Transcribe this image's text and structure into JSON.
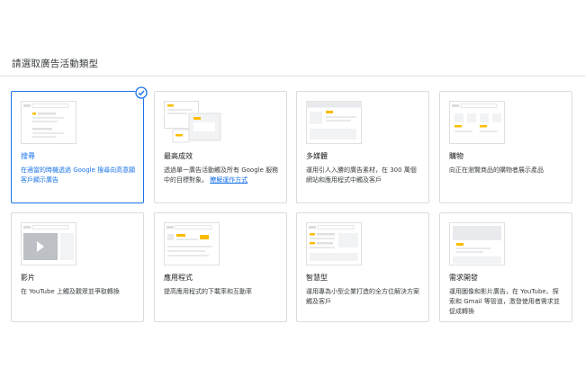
{
  "page": {
    "title": "請選取廣告活動類型"
  },
  "colors": {
    "selected_accent": "#1a73e8",
    "thumb_accent": "#fbbc04",
    "thumb_gray": "#e0e0e0"
  },
  "cards": [
    {
      "id": "search",
      "title": "搜尋",
      "desc": "在適當的時機透過 Google 搜尋向高意願客戶顯示廣告",
      "selected": true,
      "icon": "search-results-thumbnail"
    },
    {
      "id": "performance_max",
      "title": "最高成效",
      "desc": "透過單一廣告活動觸及所有 Google 服務中的目標對象。",
      "link": "瞭解運作方式",
      "selected": false,
      "icon": "multi-channel-thumbnail"
    },
    {
      "id": "display",
      "title": "多媒體",
      "desc": "運用引人入勝的廣告素材，在 300 萬個網站和應用程式中觸及客戶",
      "selected": false,
      "icon": "display-site-thumbnail"
    },
    {
      "id": "shopping",
      "title": "購物",
      "desc": "向正在瀏覽商品的購物者展示產品",
      "selected": false,
      "icon": "shopping-grid-thumbnail"
    },
    {
      "id": "video",
      "title": "影片",
      "desc": "在 YouTube 上觸及觀眾並爭取轉換",
      "selected": false,
      "icon": "video-player-thumbnail"
    },
    {
      "id": "app",
      "title": "應用程式",
      "desc": "提高應用程式的下載率和互動率",
      "selected": false,
      "icon": "app-listing-thumbnail"
    },
    {
      "id": "smart",
      "title": "智慧型",
      "desc": "運用專為小型企業打造的全方位解決方案觸及客戶",
      "selected": false,
      "icon": "smart-mixed-thumbnail"
    },
    {
      "id": "demand_gen",
      "title": "需求開發",
      "desc": "運用圖像和影片廣告，在 YouTube、探索和 Gmail 等管道，激發使用者需求並促成轉換",
      "selected": false,
      "icon": "feed-thumbnail"
    }
  ]
}
